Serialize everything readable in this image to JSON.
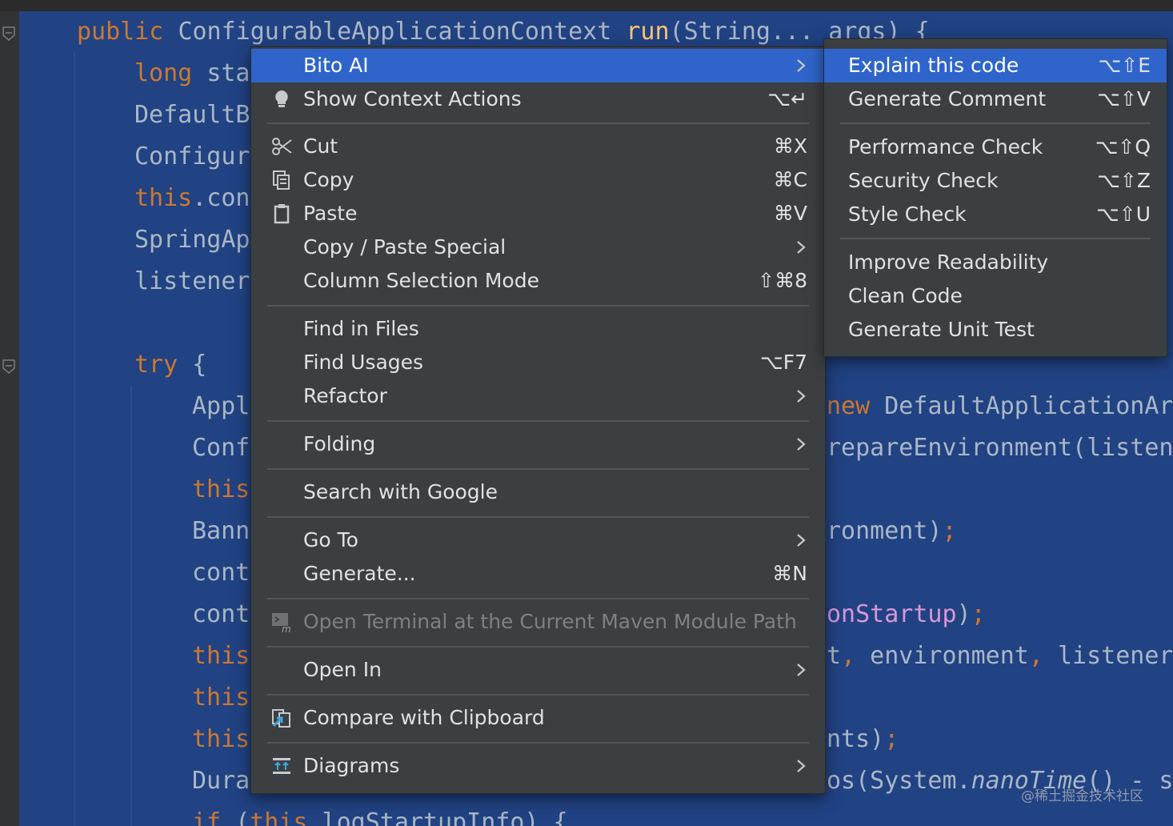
{
  "editor": {
    "lines": [
      {
        "text": "public ConfigurableApplicationContext run(String... args) {"
      },
      {
        "text": "long sta"
      },
      {
        "text": "DefaultB"
      },
      {
        "text": "Configur"
      },
      {
        "text": "this.con"
      },
      {
        "text": "SpringAp"
      },
      {
        "text": "listener"
      },
      {
        "text": "try {"
      },
      {
        "text": "Appl",
        "right": "new DefaultApplicationAr"
      },
      {
        "text": "Conf",
        "right": "repareEnvironment(listen"
      },
      {
        "text": "this"
      },
      {
        "text": "Bann",
        "right": "ronment);"
      },
      {
        "text": "cont"
      },
      {
        "text": "cont",
        "right": "onStartup);"
      },
      {
        "text": "this",
        "right": "t, environment, listener"
      },
      {
        "text": "this"
      },
      {
        "text": "this",
        "right": "nts);"
      },
      {
        "text": "Dura",
        "right": "os(System.nanoTime() - s"
      },
      {
        "text": "if (this.logStartupInfo) {"
      }
    ]
  },
  "context_menu": {
    "items": [
      {
        "label": "Bito AI",
        "shortcut": "",
        "icon": "",
        "submenu": true,
        "selected": true
      },
      {
        "label": "Show Context Actions",
        "shortcut": "⌥↵",
        "icon": "lightbulb-icon"
      },
      {
        "label": "Cut",
        "shortcut": "⌘X",
        "icon": "scissors-icon"
      },
      {
        "label": "Copy",
        "shortcut": "⌘C",
        "icon": "copy-icon"
      },
      {
        "label": "Paste",
        "shortcut": "⌘V",
        "icon": "clipboard-icon"
      },
      {
        "label": "Copy / Paste Special",
        "shortcut": "",
        "submenu": true
      },
      {
        "label": "Column Selection Mode",
        "shortcut": "⇧⌘8"
      },
      {
        "label": "Find in Files",
        "shortcut": ""
      },
      {
        "label": "Find Usages",
        "shortcut": "⌥F7"
      },
      {
        "label": "Refactor",
        "shortcut": "",
        "submenu": true
      },
      {
        "label": "Folding",
        "shortcut": "",
        "submenu": true
      },
      {
        "label": "Search with Google",
        "shortcut": ""
      },
      {
        "label": "Go To",
        "shortcut": "",
        "submenu": true
      },
      {
        "label": "Generate...",
        "shortcut": "⌘N"
      },
      {
        "label": "Open Terminal at the Current Maven Module Path",
        "shortcut": "",
        "icon": "terminal-maven-icon",
        "disabled": true
      },
      {
        "label": "Open In",
        "shortcut": "",
        "submenu": true
      },
      {
        "label": "Compare with Clipboard",
        "shortcut": "",
        "icon": "compare-icon"
      },
      {
        "label": "Diagrams",
        "shortcut": "",
        "icon": "diagram-icon",
        "submenu": true
      }
    ]
  },
  "bito_submenu": {
    "items": [
      {
        "label": "Explain this code",
        "shortcut": "⌥⇧E",
        "selected": true
      },
      {
        "label": "Generate Comment",
        "shortcut": "⌥⇧V"
      },
      {
        "label": "Performance Check",
        "shortcut": "⌥⇧Q"
      },
      {
        "label": "Security Check",
        "shortcut": "⌥⇧Z"
      },
      {
        "label": "Style Check",
        "shortcut": "⌥⇧U"
      },
      {
        "label": "Improve Readability",
        "shortcut": ""
      },
      {
        "label": "Clean Code",
        "shortcut": ""
      },
      {
        "label": "Generate Unit Test",
        "shortcut": ""
      }
    ]
  },
  "watermark": "@稀土掘金技术社区",
  "colors": {
    "editor_selection": "#214283",
    "menu_bg": "#3c3f41",
    "menu_selected": "#2f65ca",
    "keyword": "#cc7832",
    "method": "#ffc66d"
  }
}
